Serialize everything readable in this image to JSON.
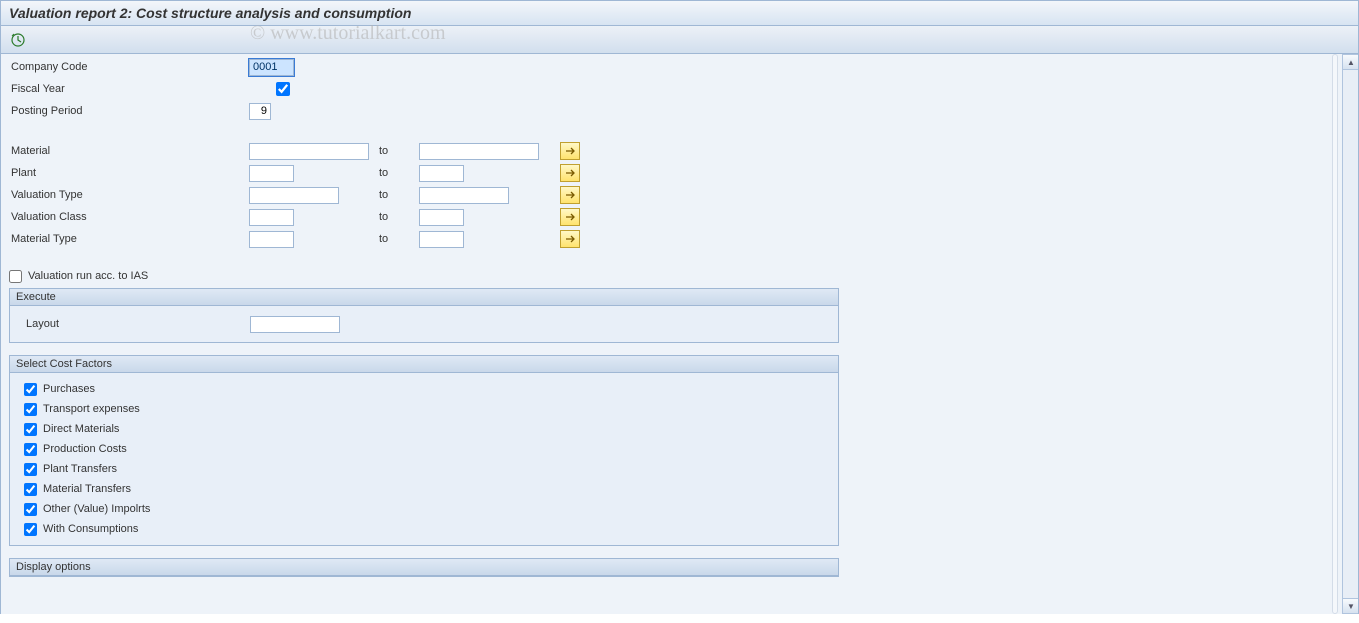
{
  "title": "Valuation report 2: Cost structure analysis and consumption",
  "watermark": "© www.tutorialkart.com",
  "header_fields": {
    "company_code": {
      "label": "Company Code",
      "value": "0001"
    },
    "fiscal_year": {
      "label": "Fiscal Year",
      "checked": true
    },
    "posting_period": {
      "label": "Posting Period",
      "value": "9"
    }
  },
  "range_fields": {
    "to_label": "to",
    "material": {
      "label": "Material"
    },
    "plant": {
      "label": "Plant"
    },
    "valuation_type": {
      "label": "Valuation Type"
    },
    "valuation_class": {
      "label": "Valuation Class"
    },
    "material_type": {
      "label": "Material Type"
    }
  },
  "ias_checkbox": {
    "label": "Valuation run acc. to IAS",
    "checked": false
  },
  "execute_group": {
    "title": "Execute",
    "layout_label": "Layout",
    "layout_value": ""
  },
  "cost_factors_group": {
    "title": "Select Cost Factors",
    "items": [
      {
        "label": "Purchases",
        "checked": true
      },
      {
        "label": "Transport expenses",
        "checked": true
      },
      {
        "label": "Direct Materials",
        "checked": true
      },
      {
        "label": "Production Costs",
        "checked": true
      },
      {
        "label": "Plant Transfers",
        "checked": true
      },
      {
        "label": "Material Transfers",
        "checked": true
      },
      {
        "label": "Other (Value) Impolrts",
        "checked": true
      },
      {
        "label": "With Consumptions",
        "checked": true
      }
    ]
  },
  "display_options_group": {
    "title": "Display options"
  }
}
